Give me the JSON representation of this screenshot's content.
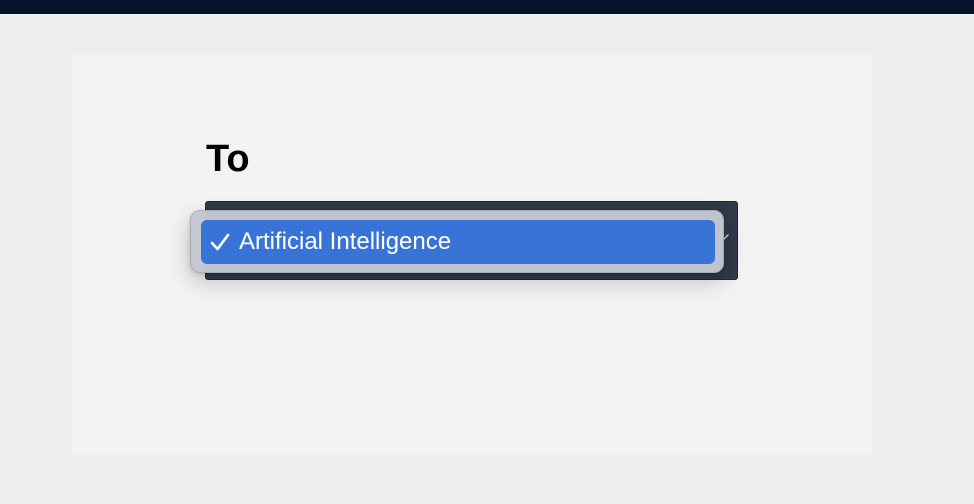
{
  "form": {
    "label": "To"
  },
  "select": {
    "options": [
      {
        "label": "Artificial Intelligence",
        "selected": true
      }
    ]
  },
  "icons": {
    "check": "check-icon",
    "chevron": "chevron-down-icon"
  },
  "colors": {
    "top_bar": "#02132b",
    "select_background": "#313a4a",
    "highlight": "#3874d8"
  }
}
